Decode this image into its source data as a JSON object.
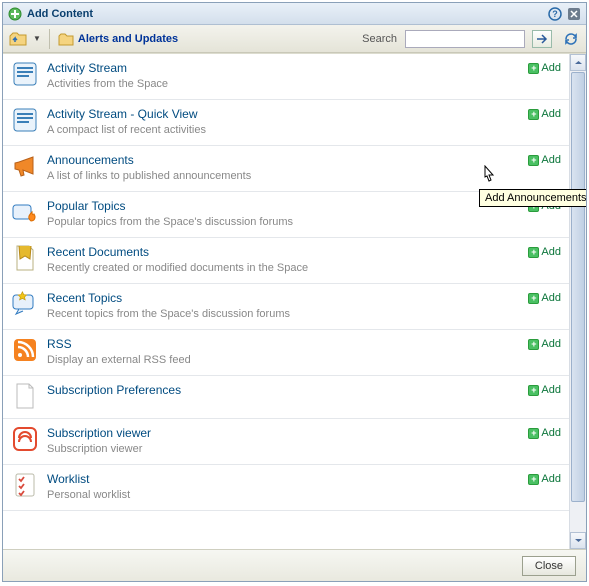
{
  "header": {
    "title": "Add Content"
  },
  "toolbar": {
    "breadcrumb": "Alerts and Updates",
    "search_label": "Search",
    "search_placeholder": ""
  },
  "items": [
    {
      "title": "Activity Stream",
      "desc": "Activities from the Space",
      "add": "Add",
      "iconColor": "#3a7fb8",
      "icon": "stream"
    },
    {
      "title": "Activity Stream - Quick View",
      "desc": "A compact list of recent activities",
      "add": "Add",
      "iconColor": "#3a7fb8",
      "icon": "stream"
    },
    {
      "title": "Announcements",
      "desc": "A list of links to published announcements",
      "add": "Add",
      "iconColor": "#f08828",
      "icon": "megaphone"
    },
    {
      "title": "Popular Topics",
      "desc": "Popular topics from the Space's discussion forums",
      "add": "Add",
      "iconColor": "#317bc0",
      "icon": "flame"
    },
    {
      "title": "Recent Documents",
      "desc": "Recently created or modified documents in the Space",
      "add": "Add",
      "iconColor": "#e5b92e",
      "icon": "doc-star"
    },
    {
      "title": "Recent Topics",
      "desc": "Recent topics from the Space's discussion forums",
      "add": "Add",
      "iconColor": "#317bc0",
      "icon": "topic-star"
    },
    {
      "title": "RSS",
      "desc": "Display an external RSS feed",
      "add": "Add",
      "iconColor": "#f58220",
      "icon": "rss"
    },
    {
      "title": "Subscription Preferences",
      "desc": "",
      "add": "Add",
      "iconColor": "#cccccc",
      "icon": "page"
    },
    {
      "title": "Subscription viewer",
      "desc": "Subscription viewer",
      "add": "Add",
      "iconColor": "#e34a2e",
      "icon": "sub"
    },
    {
      "title": "Worklist",
      "desc": "Personal worklist",
      "add": "Add",
      "iconColor": "#d94a3c",
      "icon": "checklist"
    }
  ],
  "footer": {
    "close": "Close"
  },
  "tooltip": "Add Announcements"
}
